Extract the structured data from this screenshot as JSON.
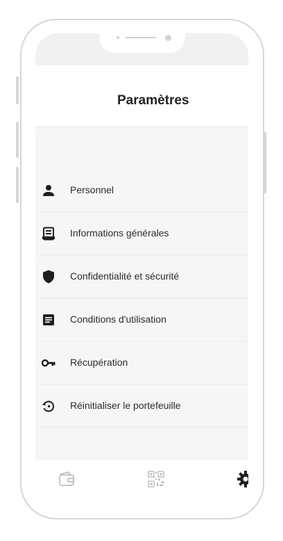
{
  "header": {
    "title": "Paramètres"
  },
  "menu": {
    "items": [
      {
        "label": "Personnel",
        "icon": "person-icon"
      },
      {
        "label": "Informations générales",
        "icon": "document-icon"
      },
      {
        "label": "Confidentialité et sécurité",
        "icon": "shield-icon"
      },
      {
        "label": "Conditions d'utilisation",
        "icon": "notes-icon"
      },
      {
        "label": "Récupération",
        "icon": "key-icon"
      },
      {
        "label": "Réinitialiser le portefeuille",
        "icon": "restore-icon"
      }
    ]
  },
  "tabbar": {
    "tabs": [
      {
        "icon": "wallet-icon"
      },
      {
        "icon": "qr-code-icon"
      },
      {
        "icon": "gear-icon",
        "active": true
      }
    ]
  },
  "colors": {
    "text": "#222222",
    "icon": "#1f1f1f",
    "frame": "#d6d6d6",
    "background": "#f6f6f6"
  }
}
